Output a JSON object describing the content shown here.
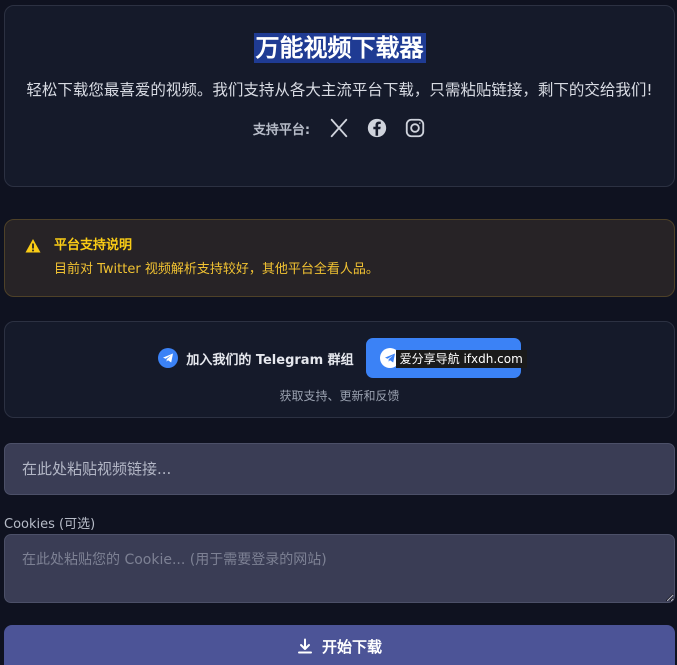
{
  "hero": {
    "title": "万能视频下载器",
    "description": "轻松下载您最喜爱的视频。我们支持从各大主流平台下载，只需粘贴链接，剩下的交给我们!",
    "platforms_label": "支持平台:",
    "platforms": [
      "x-icon",
      "facebook-icon",
      "instagram-icon"
    ]
  },
  "notice": {
    "title": "平台支持说明",
    "text": "目前对 Twitter 视频解析支持较好，其他平台全看人品。",
    "accent": "#facc15"
  },
  "telegram": {
    "label": "加入我们的 Telegram 群组",
    "watermark": "爱分享导航 ifxdh.com",
    "subtext": "获取支持、更新和反馈",
    "accent": "#3b82f6"
  },
  "form": {
    "url_placeholder": "在此处粘贴视频链接...",
    "cookie_label": "Cookies (可选)",
    "cookie_placeholder": "在此处粘贴您的 Cookie... (用于需要登录的网站)",
    "submit_label": "开始下载",
    "submit_color": "#4c5497"
  }
}
